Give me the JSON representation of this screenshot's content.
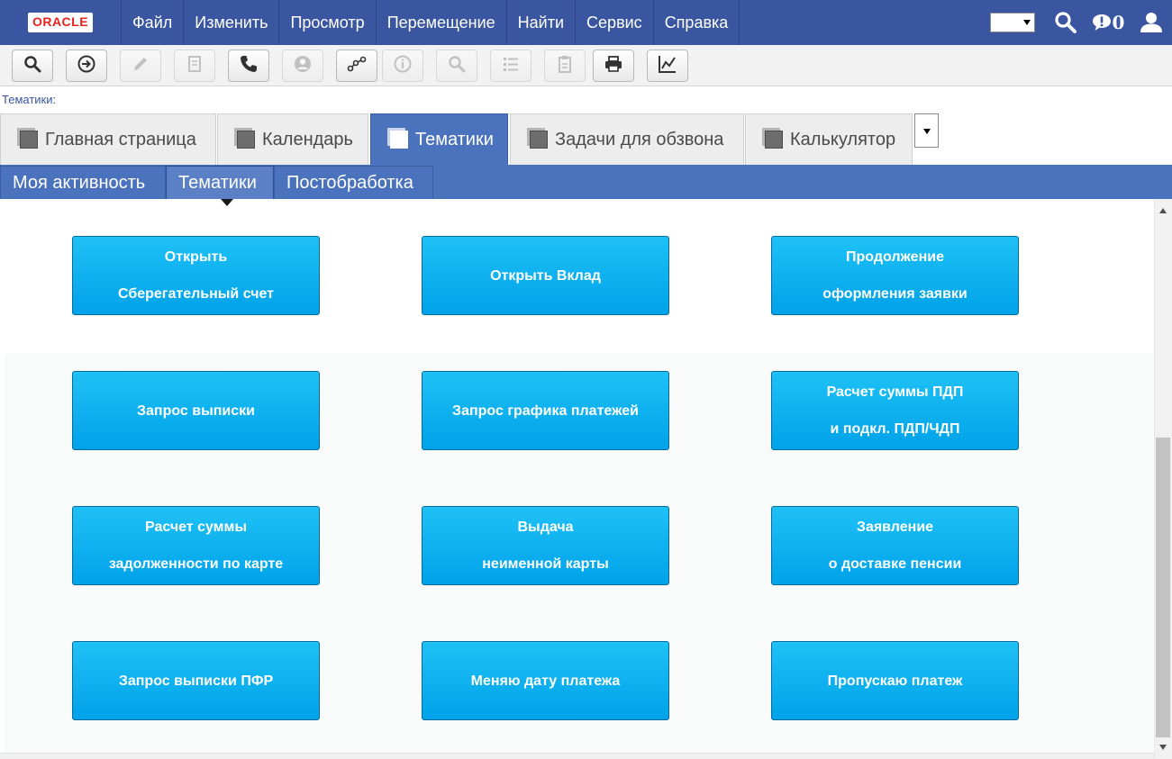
{
  "menubar": {
    "logo": "ORACLE",
    "items": [
      {
        "label": "Файл"
      },
      {
        "label": "Изменить"
      },
      {
        "label": "Просмотр"
      },
      {
        "label": "Перемещение"
      },
      {
        "label": "Найти"
      },
      {
        "label": "Сервис"
      },
      {
        "label": "Справка"
      }
    ],
    "notifications_count": "0",
    "icons": [
      "search-icon",
      "notification-icon",
      "user-icon"
    ]
  },
  "toolbar": {
    "buttons": [
      {
        "icon": "query-icon",
        "enabled": true
      },
      {
        "icon": "go-icon",
        "enabled": true
      },
      {
        "icon": "edit-icon",
        "enabled": false
      },
      {
        "icon": "document-icon",
        "enabled": false
      },
      {
        "icon": "phone-icon",
        "enabled": true
      },
      {
        "icon": "contact-icon",
        "enabled": false
      },
      {
        "icon": "workflow-icon",
        "enabled": true
      },
      {
        "icon": "info-icon",
        "enabled": false
      },
      {
        "icon": "search-icon",
        "enabled": false
      },
      {
        "icon": "list-icon",
        "enabled": false
      },
      {
        "icon": "clipboard-icon",
        "enabled": false
      },
      {
        "icon": "print-icon",
        "enabled": true
      },
      {
        "icon": "chart-icon",
        "enabled": true
      }
    ]
  },
  "breadcrumb": "Тематики:",
  "tabs": [
    {
      "label": "Главная страница",
      "active": false
    },
    {
      "label": "Календарь",
      "active": false
    },
    {
      "label": "Тематики",
      "active": true
    },
    {
      "label": "Задачи для обзвона",
      "active": false
    },
    {
      "label": "Калькулятор",
      "active": false
    }
  ],
  "subtabs": [
    {
      "label": "Моя активность",
      "active": false
    },
    {
      "label": "Тематики",
      "active": true
    },
    {
      "label": "Постобработка",
      "active": false
    }
  ],
  "tiles": [
    {
      "line1": "Открыть",
      "line2": "Сберегательный счет"
    },
    {
      "line1": "Открыть Вклад",
      "line2": ""
    },
    {
      "line1": "Продолжение",
      "line2": "оформления заявки"
    },
    {
      "line1": "Запрос выписки",
      "line2": ""
    },
    {
      "line1": "Запрос графика платежей",
      "line2": ""
    },
    {
      "line1": "Расчет суммы ПДП",
      "line2": "и подкл. ПДП/ЧДП"
    },
    {
      "line1": "Расчет суммы",
      "line2": "задолженности по карте"
    },
    {
      "line1": "Выдача",
      "line2": "неименной карты"
    },
    {
      "line1": "Заявление",
      "line2": "о доставке пенсии"
    },
    {
      "line1": "Запрос выписки ПФР",
      "line2": ""
    },
    {
      "line1": "Меняю дату платежа",
      "line2": ""
    },
    {
      "line1": "Пропускаю платеж",
      "line2": ""
    }
  ],
  "colors": {
    "menubar": "#3a56a1",
    "tab_active": "#4a72bd",
    "tile": "#00a2e9",
    "logo": "#e8231c"
  }
}
